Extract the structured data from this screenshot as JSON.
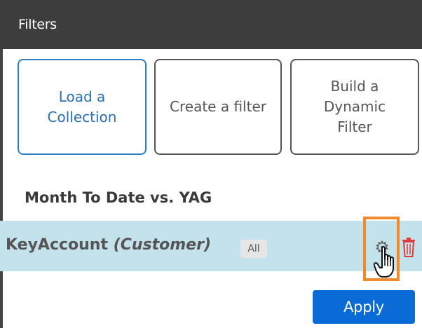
{
  "header": {
    "title": "Filters"
  },
  "actions": {
    "load_collection": "Load a\nCollection",
    "create_filter": "Create a filter",
    "build_dynamic": "Build a\nDynamic\nFilter"
  },
  "section": {
    "title": "Month To Date vs. YAG"
  },
  "filter": {
    "name": "KeyAccount",
    "type": "(Customer)",
    "badge": "All",
    "gear_icon": "gear-icon",
    "delete_icon": "trash-icon"
  },
  "footer": {
    "apply_label": "Apply"
  },
  "colors": {
    "header_bg": "#3d3d3d",
    "row_bg": "#c4e2ec",
    "primary": "#0a6bd6",
    "highlight": "#f08a2c",
    "delete": "#e03a3a"
  }
}
